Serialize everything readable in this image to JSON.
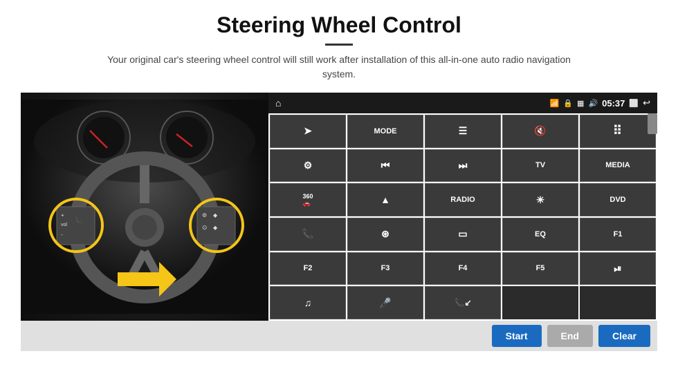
{
  "page": {
    "title": "Steering Wheel Control",
    "divider": true,
    "subtitle": "Your original car's steering wheel control will still work after installation of this all-in-one auto radio navigation system."
  },
  "topbar": {
    "home_icon": "⌂",
    "wifi_icon": "📶",
    "lock_icon": "🔒",
    "sd_icon": "📁",
    "bt_icon": "🔊",
    "time": "05:37",
    "screen_icon": "⬜",
    "back_icon": "↩"
  },
  "grid_buttons": [
    {
      "id": "row1-col1",
      "icon": "✈",
      "label": ""
    },
    {
      "id": "row1-col2",
      "label": "MODE"
    },
    {
      "id": "row1-col3",
      "icon": "☰",
      "label": ""
    },
    {
      "id": "row1-col4",
      "icon": "🔇",
      "label": ""
    },
    {
      "id": "row1-col5",
      "icon": "⣿",
      "label": ""
    },
    {
      "id": "row2-col1",
      "icon": "⊙",
      "label": ""
    },
    {
      "id": "row2-col2",
      "icon": "⏮",
      "label": ""
    },
    {
      "id": "row2-col3",
      "icon": "⏭",
      "label": ""
    },
    {
      "id": "row2-col4",
      "label": "TV"
    },
    {
      "id": "row2-col5",
      "label": "MEDIA"
    },
    {
      "id": "row3-col1",
      "icon": "360",
      "label": ""
    },
    {
      "id": "row3-col2",
      "icon": "▲",
      "label": ""
    },
    {
      "id": "row3-col3",
      "label": "RADIO"
    },
    {
      "id": "row3-col4",
      "icon": "☀",
      "label": ""
    },
    {
      "id": "row3-col5",
      "label": "DVD"
    },
    {
      "id": "row4-col1",
      "icon": "📞",
      "label": ""
    },
    {
      "id": "row4-col2",
      "icon": "⊛",
      "label": ""
    },
    {
      "id": "row4-col3",
      "icon": "▭",
      "label": ""
    },
    {
      "id": "row4-col4",
      "label": "EQ"
    },
    {
      "id": "row4-col5",
      "label": "F1"
    },
    {
      "id": "row5-col1",
      "label": "F2"
    },
    {
      "id": "row5-col2",
      "label": "F3"
    },
    {
      "id": "row5-col3",
      "label": "F4"
    },
    {
      "id": "row5-col4",
      "label": "F5"
    },
    {
      "id": "row5-col5",
      "icon": "⏯",
      "label": ""
    },
    {
      "id": "row6-col1",
      "icon": "♪",
      "label": ""
    },
    {
      "id": "row6-col2",
      "icon": "🎤",
      "label": ""
    },
    {
      "id": "row6-col3",
      "icon": "📞↙",
      "label": ""
    }
  ],
  "bottom_buttons": {
    "start": "Start",
    "end": "End",
    "clear": "Clear"
  }
}
